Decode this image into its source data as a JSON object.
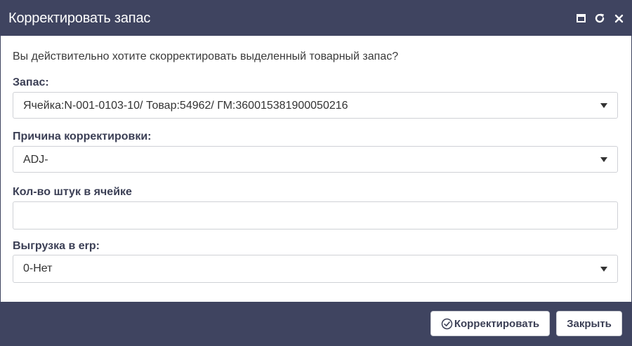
{
  "dialog": {
    "title": "Корректировать запас",
    "question": "Вы действительно хотите скорректировать выделенный товарный запас?"
  },
  "fields": {
    "stock_label": "Запас:",
    "stock_value": "Ячейка:N-001-0103-10/ Товар:54962/ ГМ:360015381900050216",
    "reason_label": "Причина корректировки:",
    "reason_value": "ADJ-",
    "qty_label": "Кол-во штук в ячейке",
    "qty_value": "",
    "erp_label": "Выгрузка в erp:",
    "erp_value": "0-Нет"
  },
  "buttons": {
    "adjust_label": "Корректировать",
    "close_label": "Закрыть"
  },
  "colors": {
    "header_bg": "#3f4460",
    "label_text": "#3b3f55"
  },
  "icons": [
    "maximize-icon",
    "refresh-icon",
    "close-icon",
    "check-circle-icon",
    "caret-down-icon"
  ]
}
